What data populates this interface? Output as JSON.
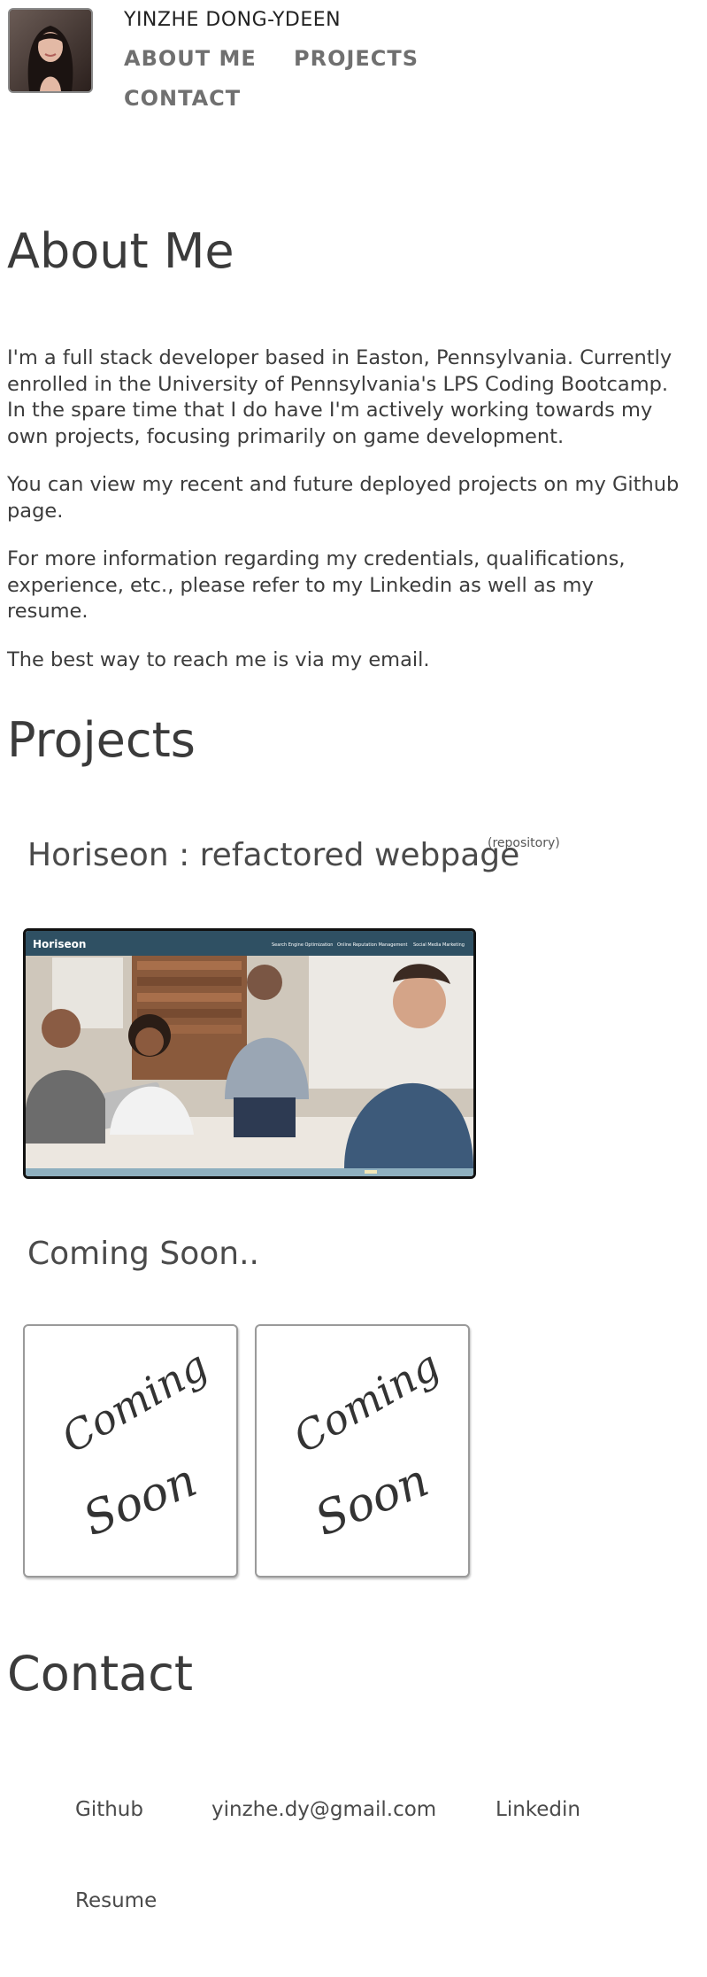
{
  "header": {
    "name": "YINZHE DONG-YDEEN",
    "nav": {
      "about": "ABOUT ME",
      "projects": "PROJECTS",
      "contact": "CONTACT"
    }
  },
  "about": {
    "heading": "About Me",
    "paragraphs": [
      "I'm a full stack developer based in Easton, Pennsylvania. Currently enrolled in the University of Pennsylvania's LPS Coding Bootcamp. In the spare time that I do have I'm actively working towards my own projects, focusing primarily on game development.",
      "You can view my recent and future deployed projects on my Github page.",
      "For more information regarding my credentials, qualifications, experience, etc., please refer to my Linkedin as well as my resume.",
      "The best way to reach me is via my email."
    ]
  },
  "projects": {
    "heading": "Projects",
    "featured": {
      "title": "Horiseon : refactored webpage",
      "repo_label": "(repository)",
      "screenshot": {
        "brand": "Horiseon",
        "nav": [
          "Search Engine Optimization",
          "Online Reputation Management",
          "Social Media Marketing"
        ]
      }
    },
    "coming_soon": {
      "title": "Coming Soon..",
      "card_text_line1": "Coming",
      "card_text_line2": "Soon"
    }
  },
  "contact": {
    "heading": "Contact",
    "links": {
      "github": "Github",
      "email": "yinzhe.dy@gmail.com",
      "linkedin": "Linkedin",
      "resume": "Resume"
    }
  },
  "colors": {
    "text": "#3c3c3c",
    "nav": "#707070",
    "thumb_header": "#2f5063",
    "thumb_footer": "#8fb0bf"
  }
}
